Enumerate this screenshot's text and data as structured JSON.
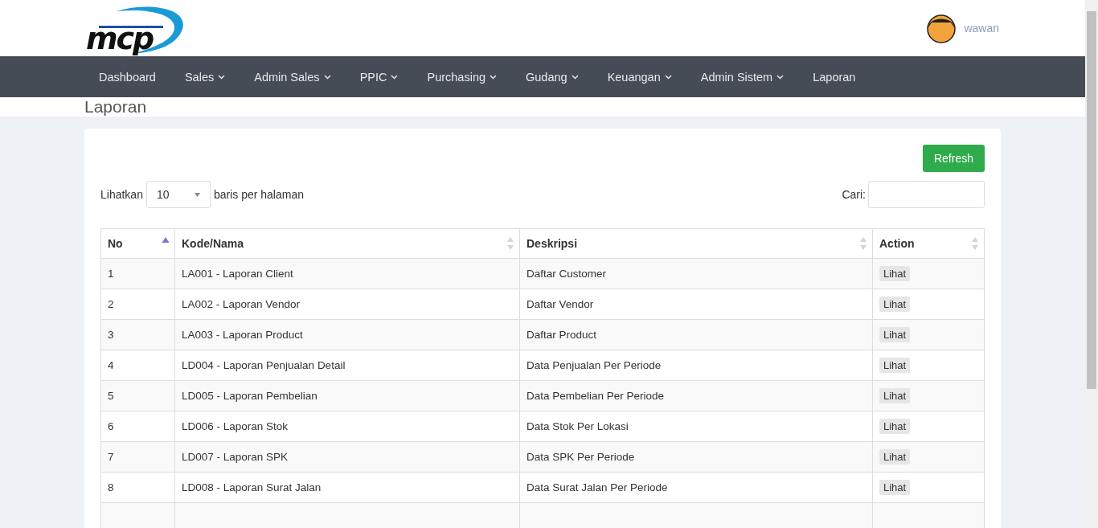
{
  "header": {
    "logo_text": "mcp",
    "user": {
      "name": "wawan"
    }
  },
  "nav": [
    {
      "label": "Dashboard",
      "has_menu": false
    },
    {
      "label": "Sales",
      "has_menu": true
    },
    {
      "label": "Admin Sales",
      "has_menu": true
    },
    {
      "label": "PPIC",
      "has_menu": true
    },
    {
      "label": "Purchasing",
      "has_menu": true
    },
    {
      "label": "Gudang",
      "has_menu": true
    },
    {
      "label": "Keuangan",
      "has_menu": true
    },
    {
      "label": "Admin Sistem",
      "has_menu": true
    },
    {
      "label": "Laporan",
      "has_menu": false
    }
  ],
  "page_title": "Laporan",
  "refresh_button": "Refresh",
  "length": {
    "before": "Lihatkan",
    "value": "10",
    "after": "baris per halaman"
  },
  "search": {
    "label": "Cari:"
  },
  "table": {
    "columns": [
      {
        "label": "No",
        "sorted": true
      },
      {
        "label": "Kode/Nama",
        "sorted": false
      },
      {
        "label": "Deskripsi",
        "sorted": false
      },
      {
        "label": "Action",
        "sorted": false
      }
    ],
    "rows": [
      {
        "no": "1",
        "name": "LA001 - Laporan Client",
        "description": "Daftar Customer",
        "action": "Lihat"
      },
      {
        "no": "2",
        "name": "LA002 - Laporan Vendor",
        "description": "Daftar Vendor",
        "action": "Lihat"
      },
      {
        "no": "3",
        "name": "LA003 - Laporan Product",
        "description": "Daftar Product",
        "action": "Lihat"
      },
      {
        "no": "4",
        "name": "LD004 - Laporan Penjualan Detail",
        "description": "Data Penjualan Per Periode",
        "action": "Lihat"
      },
      {
        "no": "5",
        "name": "LD005 - Laporan Pembelian",
        "description": "Data Pembelian Per Periode",
        "action": "Lihat"
      },
      {
        "no": "6",
        "name": "LD006 - Laporan Stok",
        "description": "Data Stok Per Lokasi",
        "action": "Lihat"
      },
      {
        "no": "7",
        "name": "LD007 - Laporan SPK",
        "description": "Data SPK Per Periode",
        "action": "Lihat"
      },
      {
        "no": "8",
        "name": "LD008 - Laporan Surat Jalan",
        "description": "Data Surat Jalan Per Periode",
        "action": "Lihat"
      }
    ]
  }
}
